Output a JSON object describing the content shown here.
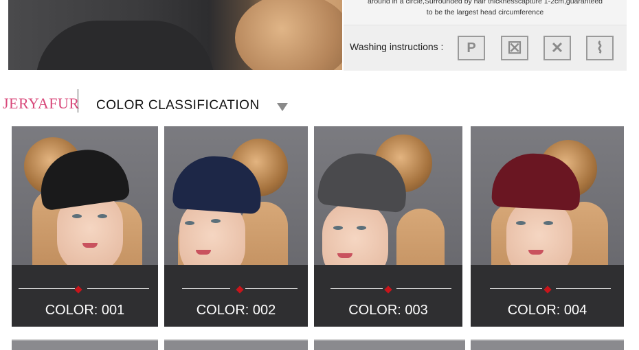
{
  "spec": {
    "line1": "around in a circle,Surrounded by hair thicknesscapture 1-2cm,guaranteed",
    "line2": "to be the largest head circumference"
  },
  "washing": {
    "label": "Washing instructions :",
    "icons": [
      {
        "name": "dry-clean-p-icon",
        "glyph": "P"
      },
      {
        "name": "do-not-tumble-dry-icon",
        "glyph": "☒"
      },
      {
        "name": "do-not-wash-icon",
        "glyph": "✕"
      },
      {
        "name": "hang-dry-icon",
        "glyph": "⌇"
      }
    ]
  },
  "header": {
    "brand": "JERYAFUR",
    "section_title": "COLOR CLASSIFICATION"
  },
  "products": [
    {
      "label": "COLOR: 001",
      "hat_color": "#1a1a1b"
    },
    {
      "label": "COLOR: 002",
      "hat_color": "#1d2747"
    },
    {
      "label": "COLOR: 003",
      "hat_color": "#4a4a4d"
    },
    {
      "label": "COLOR: 004",
      "hat_color": "#6a1622"
    }
  ],
  "colors": {
    "brand": "#d8487a",
    "accent_diamond": "#c8151b"
  }
}
